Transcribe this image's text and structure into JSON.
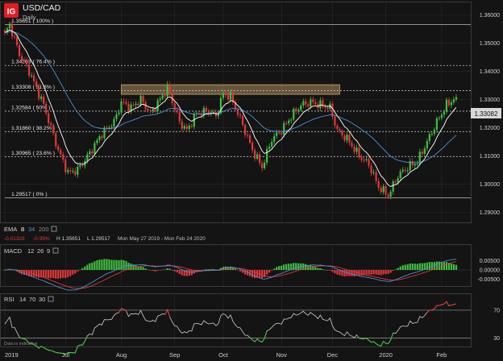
{
  "brand": {
    "logo_text": "IG",
    "logo_color": "#e41b23"
  },
  "header": {
    "symbol": "USD/CAD",
    "timeframe": "Daily"
  },
  "colors": {
    "background": "#141414",
    "up": "#3fbf3f",
    "down": "#e03838",
    "ema_fast": "#ffffff",
    "ema_mid": "#4a8fd6",
    "macd_line": "#4a8fd6",
    "macd_signal": "#e03838",
    "rsi": "#cfcfcf",
    "rsi_over": "#e03838",
    "rsi_under": "#3fbf3f",
    "zone": "#c9a46a",
    "grid": "#2a2a2a"
  },
  "price_tag": "1.33082",
  "fib_levels": [
    {
      "label": "1.35651 ( 100% )",
      "value": 1.35651
    },
    {
      "label": "1.34203 ( 76.4% )",
      "value": 1.34203
    },
    {
      "label": "1.33308 ( 61.8% )",
      "value": 1.33308
    },
    {
      "label": "1.32584 ( 50% )",
      "value": 1.32584
    },
    {
      "label": "1.31860 ( 38.2% )",
      "value": 1.3186
    },
    {
      "label": "1.30965 ( 23.6% )",
      "value": 1.30965
    },
    {
      "label": "1.29517 ( 0% )",
      "value": 1.29517
    }
  ],
  "ema_legend": {
    "label": "EMA",
    "p1": "8",
    "p2": "34",
    "p3": "200"
  },
  "stats": {
    "change": "-0.01328",
    "change_pct": "-0.99%",
    "high": "H 1.35651",
    "low": "L 1.29517",
    "range": "Mon May 27 2019 - Mon Feb 24 2020"
  },
  "macd_legend": {
    "label": "MACD",
    "p1": "12",
    "p2": "26",
    "p3": "9"
  },
  "rsi_legend": {
    "label": "RSI",
    "p1": "14",
    "p2": "70",
    "p3": "30"
  },
  "disclaimer": "Data is indicative",
  "chart_data": {
    "type": "candlestick",
    "price_axis": {
      "ticks": [
        "1.36000",
        "1.35000",
        "1.34000",
        "1.33000",
        "1.32000",
        "1.31000",
        "1.30000",
        "1.29000"
      ],
      "values": [
        1.36,
        1.35,
        1.34,
        1.33,
        1.32,
        1.31,
        1.3,
        1.29
      ],
      "ylim": [
        1.287,
        1.3635
      ]
    },
    "macd_axis": {
      "ticks": [
        "0.00500",
        "0.00000",
        "-0.00500"
      ],
      "values": [
        0.005,
        0.0,
        -0.005
      ],
      "ylim": [
        -0.0075,
        0.0075
      ]
    },
    "rsi_axis": {
      "ticks": [
        "70",
        "30"
      ],
      "values": [
        70,
        30
      ],
      "ylim": [
        20,
        85
      ]
    },
    "x_labels": [
      {
        "label": "2019",
        "day": 0
      },
      {
        "label": "Jul",
        "day": 25
      },
      {
        "label": "Aug",
        "day": 48
      },
      {
        "label": "Sep",
        "day": 70
      },
      {
        "label": "Oct",
        "day": 90
      },
      {
        "label": "Nov",
        "day": 114
      },
      {
        "label": "Dec",
        "day": 135
      },
      {
        "label": "2020",
        "day": 157
      },
      {
        "label": "Feb",
        "day": 180
      }
    ],
    "resistance_zone": {
      "from_day": 48,
      "to_day": 138,
      "low": 1.3318,
      "high": 1.3352
    },
    "anchors": [
      [
        0,
        1.353
      ],
      [
        2,
        1.3565
      ],
      [
        6,
        1.346
      ],
      [
        10,
        1.34
      ],
      [
        16,
        1.328
      ],
      [
        22,
        1.312
      ],
      [
        26,
        1.304
      ],
      [
        30,
        1.305
      ],
      [
        35,
        1.311
      ],
      [
        40,
        1.318
      ],
      [
        45,
        1.322
      ],
      [
        48,
        1.329
      ],
      [
        52,
        1.327
      ],
      [
        56,
        1.33
      ],
      [
        60,
        1.325
      ],
      [
        64,
        1.33
      ],
      [
        67,
        1.334
      ],
      [
        72,
        1.322
      ],
      [
        75,
        1.319
      ],
      [
        79,
        1.325
      ],
      [
        84,
        1.326
      ],
      [
        87,
        1.324
      ],
      [
        90,
        1.332
      ],
      [
        93,
        1.331
      ],
      [
        98,
        1.321
      ],
      [
        102,
        1.312
      ],
      [
        106,
        1.306
      ],
      [
        110,
        1.316
      ],
      [
        114,
        1.319
      ],
      [
        118,
        1.324
      ],
      [
        122,
        1.328
      ],
      [
        126,
        1.329
      ],
      [
        130,
        1.328
      ],
      [
        134,
        1.327
      ],
      [
        137,
        1.319
      ],
      [
        141,
        1.316
      ],
      [
        146,
        1.31
      ],
      [
        150,
        1.307
      ],
      [
        154,
        1.299
      ],
      [
        158,
        1.296
      ],
      [
        162,
        1.303
      ],
      [
        166,
        1.306
      ],
      [
        170,
        1.308
      ],
      [
        174,
        1.315
      ],
      [
        178,
        1.322
      ],
      [
        182,
        1.328
      ],
      [
        186,
        1.3308
      ]
    ]
  }
}
